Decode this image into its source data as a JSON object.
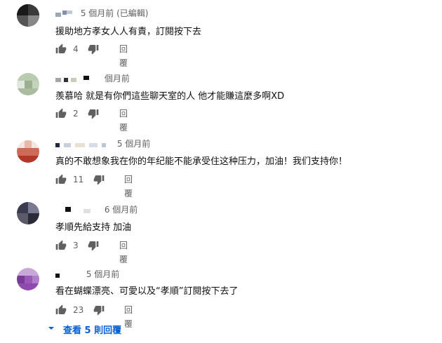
{
  "comments": [
    {
      "time": "5 個月前 (已編輯)",
      "text": "援助地方孝女人人有責，訂閱按下去",
      "likes": "4",
      "reply": "回覆",
      "avatar_colors": [
        "#222222",
        "#444444",
        "#666666",
        "#999999"
      ]
    },
    {
      "time": "個月前",
      "text": "羨慕哈 就是有你們這些聊天室的人 他才能賺這麼多啊XD",
      "likes": "2",
      "reply": "回覆",
      "avatar_colors": [
        "#a8c09a",
        "#c8d8c0",
        "#8aa080",
        "#e0e8dc"
      ]
    },
    {
      "time": "5 個月前",
      "text": "真的不敢想象我在你的年纪能不能承受住这种压力，加油！我们支持你！",
      "likes": "11",
      "reply": "回覆",
      "avatar_colors": [
        "#c0392b",
        "#e8b0a0",
        "#8e2a20",
        "#f0d8d0"
      ]
    },
    {
      "time": "6 個月前",
      "text": "孝順先給支持 加油",
      "likes": "3",
      "reply": "回覆",
      "avatar_colors": [
        "#2a2a3a",
        "#6a6a80",
        "#4a4a60",
        "#b0b0c0"
      ]
    },
    {
      "time": "5 個月前",
      "text": "看在蝴蝶漂亮、可愛以及“孝順”訂閱按下去了",
      "likes": "23",
      "reply": "回覆",
      "avatar_colors": [
        "#8e44ad",
        "#b07cc8",
        "#6c2a8a",
        "#d8b8e8"
      ]
    }
  ],
  "view_replies": "查看 5 則回覆",
  "colors": {
    "link": "#065fd4",
    "meta": "#606060",
    "text": "#0f0f0f"
  }
}
